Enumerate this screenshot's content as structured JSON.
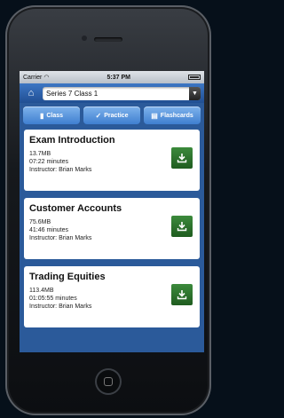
{
  "status": {
    "carrier": "Carrier",
    "time": "5:37 PM",
    "wifi_icon": "wifi-icon",
    "battery_icon": "battery-icon"
  },
  "nav": {
    "home_icon": "home-icon",
    "selected_course": "Series 7 Class 1"
  },
  "tabs": [
    {
      "label": "Class",
      "icon": "book-icon"
    },
    {
      "label": "Practice",
      "icon": "check-icon"
    },
    {
      "label": "Flashcards",
      "icon": "cards-icon"
    }
  ],
  "lessons": [
    {
      "title": "Exam Introduction",
      "size": "13.7MB",
      "duration": "07:22 minutes",
      "instructor": "Instructor: Brian Marks"
    },
    {
      "title": "Customer Accounts",
      "size": "75.6MB",
      "duration": "41:46 minutes",
      "instructor": "Instructor: Brian Marks"
    },
    {
      "title": "Trading Equities",
      "size": "113.4MB",
      "duration": "01:05:55 minutes",
      "instructor": "Instructor: Brian Marks"
    }
  ],
  "colors": {
    "accent": "#2b5a9a",
    "download": "#2e7a2e"
  }
}
